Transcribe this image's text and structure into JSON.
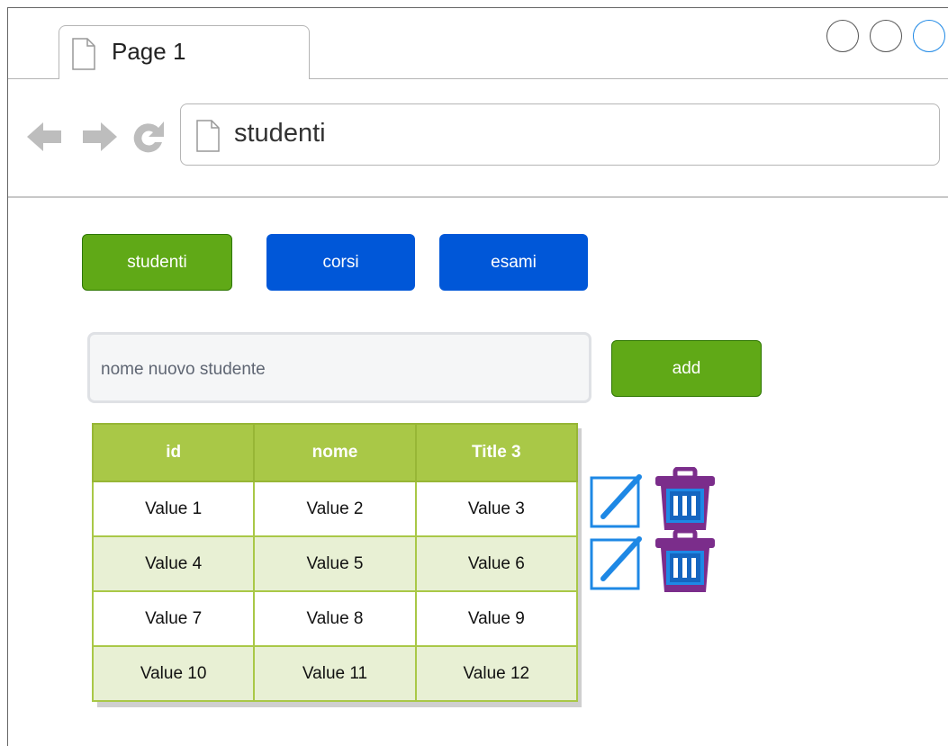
{
  "browser": {
    "tab_title": "Page 1",
    "address": "studenti"
  },
  "nav": {
    "buttons": [
      {
        "label": "studenti",
        "active": true
      },
      {
        "label": "corsi",
        "active": false
      },
      {
        "label": "esami",
        "active": false
      }
    ]
  },
  "form": {
    "placeholder": "nome nuovo studente",
    "add_label": "add"
  },
  "table": {
    "headers": [
      "id",
      "nome",
      "Title 3"
    ],
    "rows": [
      [
        "Value 1",
        "Value 2",
        "Value 3"
      ],
      [
        "Value 4",
        "Value 5",
        "Value 6"
      ],
      [
        "Value 7",
        "Value 8",
        "Value 9"
      ],
      [
        "Value 10",
        "Value 11",
        "Value 12"
      ]
    ]
  },
  "icons": {
    "row_actions": [
      "edit-icon",
      "trash-icon"
    ],
    "browser": [
      "back-arrow-icon",
      "forward-arrow-icon",
      "refresh-icon",
      "page-icon"
    ]
  },
  "colors": {
    "green": "#60a917",
    "blue": "#0057d8",
    "header_green": "#a9c847",
    "stripe": "#e8f0d4",
    "edit_blue": "#1e88e5",
    "trash_purple": "#7b2d8b"
  }
}
